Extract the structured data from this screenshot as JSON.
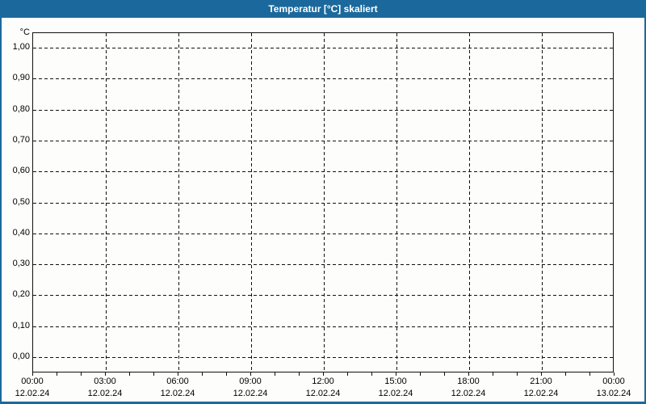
{
  "window": {
    "title": "Temperatur [°C] skaliert"
  },
  "colors": {
    "titlebar_bg": "#1b699c",
    "window_border": "#1b699c",
    "title_text": "#ffffff",
    "plot_bg": "#fdfdfc",
    "grid_color": "#111111",
    "tick_text": "#000000"
  },
  "chart_data": {
    "type": "line",
    "title": "Temperatur [°C] skaliert",
    "xlabel": "",
    "ylabel": "°C",
    "ylim": [
      0.0,
      1.0
    ],
    "y_tick_step": 0.1,
    "y_tick_labels": [
      "1,00",
      "0,90",
      "0,80",
      "0,70",
      "0,60",
      "0,50",
      "0,40",
      "0,30",
      "0,20",
      "0,10",
      "0,00"
    ],
    "x_major_ticks": [
      {
        "time": "00:00",
        "date": "12.02.24"
      },
      {
        "time": "03:00",
        "date": "12.02.24"
      },
      {
        "time": "06:00",
        "date": "12.02.24"
      },
      {
        "time": "09:00",
        "date": "12.02.24"
      },
      {
        "time": "12:00",
        "date": "12.02.24"
      },
      {
        "time": "15:00",
        "date": "12.02.24"
      },
      {
        "time": "18:00",
        "date": "12.02.24"
      },
      {
        "time": "21:00",
        "date": "12.02.24"
      },
      {
        "time": "00:00",
        "date": "13.02.24"
      }
    ],
    "hours_per_major_interval": 3,
    "minor_ticks_every_hour": true,
    "grid_style": "dashed",
    "legend": null,
    "series": []
  }
}
